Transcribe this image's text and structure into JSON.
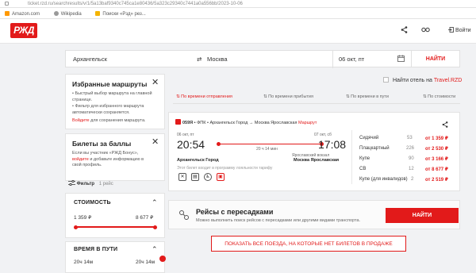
{
  "browser": {
    "url": "ticket.rzd.ru/searchresults/v/1/5a13baf9340c745ca1e80436/5a323c29340c7441a0a556bb/2023-10-06",
    "bookmarks": [
      "Amazon.com",
      "Wikipedia",
      "Поиски «Рзд» рез..."
    ]
  },
  "header": {
    "logo": "РЖД",
    "share_icon": "share-icon",
    "glasses_icon": "accessibility-icon",
    "login": "Войти"
  },
  "search": {
    "from": "Архангельск",
    "swap": "⇄",
    "to": "Москва",
    "date": "06 окт, пт",
    "button": "НАЙТИ"
  },
  "hotel": {
    "label": "Найти отель на ",
    "link": "Travel.RZD"
  },
  "favorites": {
    "title": "Избранные маршруты",
    "items": [
      "Быстрый выбор маршрута на главной странице.",
      "Фильтр для избранного маршрута автоматически сохраняется."
    ],
    "login_link": "Войдите",
    "login_text": " для сохранения маршрута."
  },
  "bonus": {
    "title": "Билеты за баллы",
    "line1": "Если вы участник «РЖД Бонус»,",
    "login_link": "войдите",
    "line2": " и добавьте информацию в",
    "line3": "свой профиль."
  },
  "filter": {
    "label": "Фильтр",
    "count": "1 рейс"
  },
  "cost": {
    "title": "СТОИМОСТЬ",
    "min": "1 359 ₽",
    "max": "8 677 ₽",
    "range_fraction": [
      0,
      1
    ]
  },
  "travel_time": {
    "title": "ВРЕМЯ В ПУТИ",
    "min": "20ч 14м",
    "max": "20ч 14м"
  },
  "sort": [
    "По времени отправления",
    "По времени прибытия",
    "По времени в пути",
    "По стоимости"
  ],
  "train": {
    "number": "059Я",
    "carrier": "ФПК",
    "route": "Архангельск Город → Москва Ярославская",
    "route_link": "Маршрут",
    "dep_date": "06 окт, пт",
    "dep_time": "20:54",
    "arr_date": "07 окт, сб",
    "arr_time": "17:08",
    "duration": "20 ч 14 мин",
    "dep_station": "Архангельск Город",
    "arr_station_note": "Ярославский вокзал",
    "arr_station": "Москва Ярославская",
    "note": "Этот билет входит в программу лояльности тарифу",
    "classes": [
      {
        "name": "Сидячий",
        "seats": "53",
        "price": "от 1 359 ₽"
      },
      {
        "name": "Плацкартный",
        "seats": "226",
        "price": "от 2 530 ₽"
      },
      {
        "name": "Купе",
        "seats": "90",
        "price": "от 3 166 ₽"
      },
      {
        "name": "СВ",
        "seats": "12",
        "price": "от 8 677 ₽"
      },
      {
        "name": "Купе (для инвалидов)",
        "seats": "2",
        "price": "от 2 519 ₽"
      }
    ]
  },
  "transfer": {
    "title": "Рейсы с пересадками",
    "subtitle": "Можно выполнить поиск рейсов с пересадками или другими видами транспорта.",
    "button": "НАЙТИ"
  },
  "show_all": "ПОКАЗАТЬ ВСЕ ПОЕЗДА, НА КОТОРЫЕ НЕТ БИЛЕТОВ В ПРОДАЖЕ"
}
